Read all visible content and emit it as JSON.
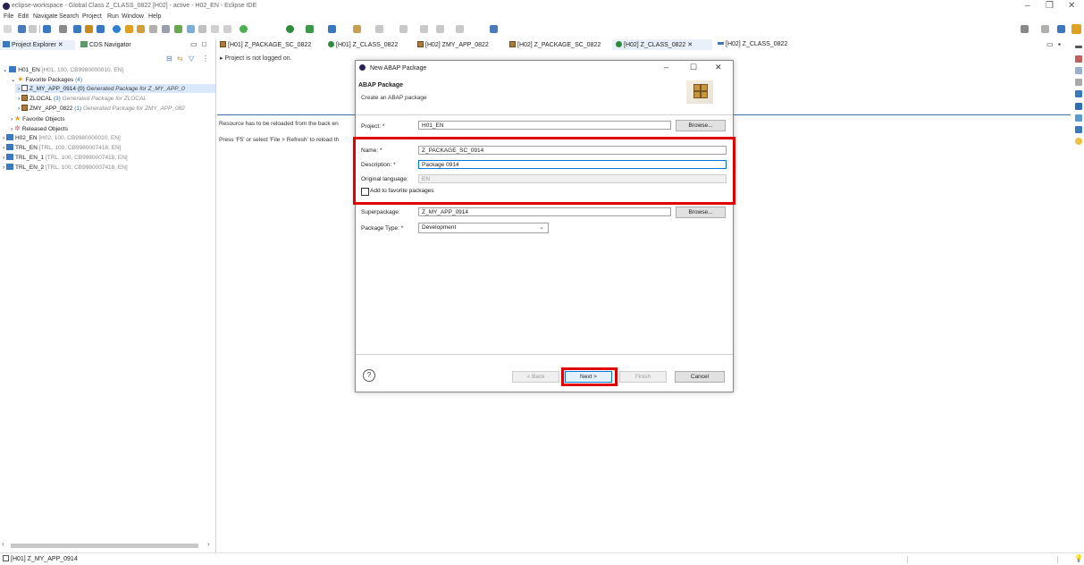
{
  "window": {
    "title": "eclipse-workspace - Global Class Z_CLASS_0822 [H02] - active - H02_EN - Eclipse IDE",
    "controls": [
      "–",
      "❐",
      "✕"
    ]
  },
  "menu": [
    "File",
    "Edit",
    "Navigate",
    "Search",
    "Project",
    "Run",
    "Window",
    "Help"
  ],
  "left_panel": {
    "tabs": [
      {
        "label": "Project Explorer ✕",
        "active": true
      },
      {
        "label": "CDS Navigator",
        "active": false
      }
    ],
    "tree": [
      {
        "label": "H01_EN",
        "meta": "[H01, 100, CB9980000010, EN]"
      },
      {
        "label": "Favorite Packages",
        "meta": "(4)"
      },
      {
        "label": "Z_MY_APP_0914 (0)",
        "meta": "Generated Package for Z_MY_APP_0"
      },
      {
        "label": "ZLOCAL",
        "count": "(3)",
        "meta": "Generated Package for ZLOCAL"
      },
      {
        "label": "ZMY_APP_0822",
        "count": "(1)",
        "meta": "Generated Package for ZMY_APP_082"
      },
      {
        "label": "Favorite Objects",
        "meta": ""
      },
      {
        "label": "Released Objects",
        "meta": ""
      },
      {
        "label": "H02_EN",
        "meta": "[H02, 100, CB9980000010, EN]"
      },
      {
        "label": "TRL_EN",
        "meta": "[TRL, 100, CB9980007418, EN]"
      },
      {
        "label": "TRL_EN_1",
        "meta": "[TRL, 100, CB9980007418, EN]"
      },
      {
        "label": "TRL_EN_2",
        "meta": "[TRL, 100, CB9980007418, EN]"
      }
    ]
  },
  "editor": {
    "tabs": [
      "[H01] Z_PACKAGE_SC_0822",
      "[H01] Z_CLASS_0822",
      "[H02] ZMY_APP_0822",
      "[H02] Z_PACKAGE_SC_0822",
      "[H02] Z_CLASS_0822 ✕",
      "[H02] Z_CLASS_0822"
    ],
    "not_logged_on": "Project is not logged on.",
    "resource_msg": "Resource has to be reloaded from the back en",
    "refresh_msg": "Press 'F5' or select 'File > Refresh' to reload th"
  },
  "dialog": {
    "window_title": "New ABAP Package",
    "header_title": "ABAP Package",
    "header_subtitle": "Create an ABAP package",
    "project_label": "Project: *",
    "project_value": "H01_EN",
    "browse_label": "Browse...",
    "name_label": "Name: *",
    "name_value": "Z_PACKAGE_SC_0914",
    "description_label": "Description: *",
    "description_value": "Package 0914",
    "original_language_label": "Original language:",
    "original_language_value": "EN",
    "favorite_label": "Add to favorite packages",
    "superpackage_label": "Superpackage:",
    "superpackage_value": "Z_MY_APP_0914",
    "package_type_label": "Package Type: *",
    "package_type_value": "Development",
    "help_glyph": "?",
    "back_label": "< Back",
    "next_label": "Next >",
    "finish_label": "Finish",
    "cancel_label": "Cancel",
    "min_glyph": "–",
    "max_glyph": "☐",
    "close_glyph": "✕"
  },
  "status": {
    "left_text": "[H01] Z_MY_APP_0914"
  },
  "colors": {
    "highlight": "#e00000",
    "accent": "#0078d7"
  }
}
